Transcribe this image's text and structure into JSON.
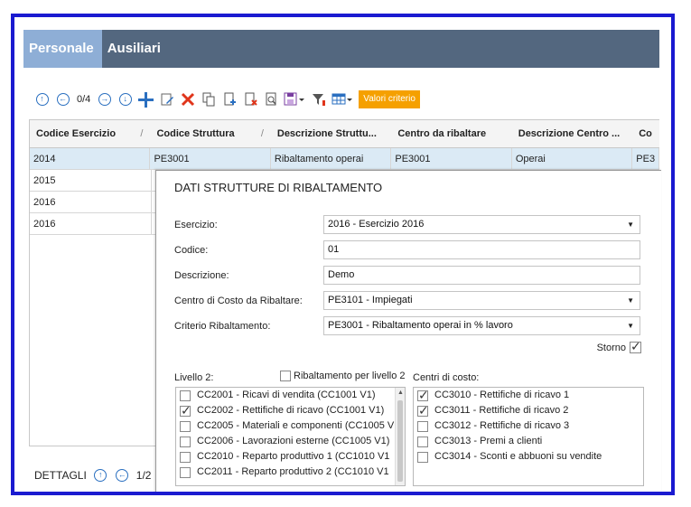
{
  "tabs": [
    {
      "label": "Personale",
      "active": true
    },
    {
      "label": "Ausiliari",
      "active": false
    }
  ],
  "toolbar": {
    "pager": "0/4",
    "valori_criterio": "Valori criterio"
  },
  "grid": {
    "columns": [
      "Codice Esercizio",
      "Codice Struttura",
      "Descrizione Struttu...",
      "Centro  da ribaltare",
      "Descrizione Centro ...",
      "Co"
    ],
    "rows": [
      [
        "2014",
        "PE3001",
        "Ribaltamento operai",
        "PE3001",
        "Operai",
        "PE3"
      ],
      [
        "2015",
        "",
        "",
        "",
        "",
        ""
      ],
      [
        "2016",
        "",
        "",
        "",
        "",
        ""
      ],
      [
        "2016",
        "",
        "",
        "",
        "",
        ""
      ]
    ]
  },
  "dettagli": {
    "label": "DETTAGLI",
    "pager": "1/2"
  },
  "dialog": {
    "title": "DATI STRUTTURE DI RIBALTAMENTO",
    "fields": {
      "esercizio": {
        "label": "Esercizio:",
        "value": "2016 - Esercizio 2016"
      },
      "codice": {
        "label": "Codice:",
        "value": "01"
      },
      "descrizione": {
        "label": "Descrizione:",
        "value": "Demo"
      },
      "centro": {
        "label": "Centro di Costo da Ribaltare:",
        "value": "PE3101 - Impiegati"
      },
      "criterio": {
        "label": "Criterio Ribaltamento:",
        "value": "PE3001 - Ribaltamento operai in % lavoro"
      }
    },
    "storno": {
      "label": "Storno",
      "checked": true
    },
    "livello2": {
      "label": "Livello 2:",
      "ribaltamento_label": "Ribaltamento per livello 2"
    },
    "centri_label": "Centri di costo:",
    "left_items": [
      {
        "label": "CC2001 - Ricavi di vendita (CC1001 V1)",
        "checked": false
      },
      {
        "label": "CC2002 - Rettifiche di ricavo (CC1001 V1)",
        "checked": true
      },
      {
        "label": "CC2005 - Materiali e componenti (CC1005 V",
        "checked": false
      },
      {
        "label": "CC2006 - Lavorazioni esterne (CC1005 V1)",
        "checked": false
      },
      {
        "label": "CC2010 - Reparto produttivo 1 (CC1010 V1",
        "checked": false
      },
      {
        "label": "CC2011 - Reparto produttivo 2 (CC1010 V1",
        "checked": false
      }
    ],
    "right_items": [
      {
        "label": "CC3010 - Rettifiche di ricavo 1",
        "checked": true
      },
      {
        "label": "CC3011 - Rettifiche di ricavo 2",
        "checked": true
      },
      {
        "label": "CC3012 - Rettifiche di ricavo 3",
        "checked": false
      },
      {
        "label": "CC3013 - Premi a clienti",
        "checked": false
      },
      {
        "label": "CC3014 - Sconti e abbuoni su vendite",
        "checked": false
      }
    ]
  },
  "colors": {
    "frame": "#1a1ad0",
    "header": "#53677f",
    "active_tab": "#8eaed6",
    "accent": "#f5a000",
    "selected_row": "#dbeaf5"
  }
}
